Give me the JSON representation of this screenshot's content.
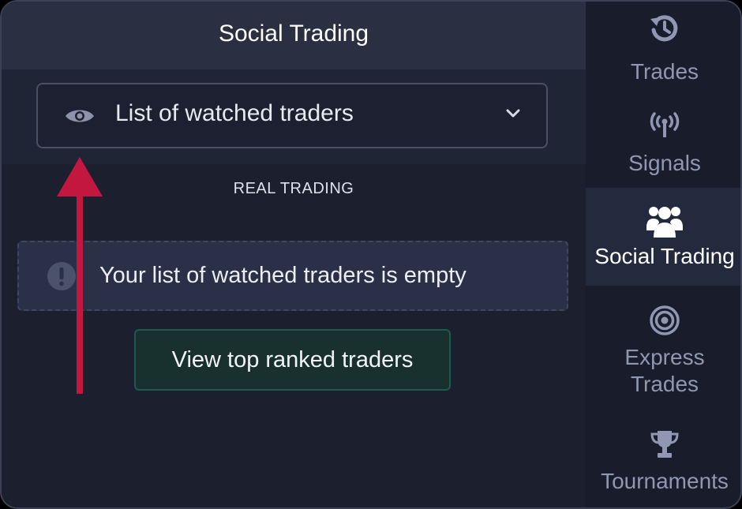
{
  "main": {
    "title": "Social Trading",
    "dropdown_label": "List of watched traders",
    "section_label": "REAL TRADING",
    "empty_message": "Your list of watched traders is empty",
    "view_button_label": "View top ranked traders"
  },
  "sidebar": {
    "items": [
      {
        "label": "Trades",
        "icon": "history-icon"
      },
      {
        "label": "Signals",
        "icon": "signal-antenna-icon"
      },
      {
        "label": "Social Trading",
        "icon": "users-group-icon",
        "active": true
      },
      {
        "label_line1": "Express",
        "label_line2": "Trades",
        "icon": "target-icon"
      },
      {
        "label": "Tournaments",
        "icon": "trophy-icon"
      }
    ]
  },
  "colors": {
    "panel_bg": "#1b1f2e",
    "header_bg": "#2a2f41",
    "sidebar_bg": "#191d2b",
    "active_bg": "#242a3d",
    "arrow": "#c4173f",
    "button_border": "#1d5a4a",
    "inactive_text": "#8f97b3"
  }
}
